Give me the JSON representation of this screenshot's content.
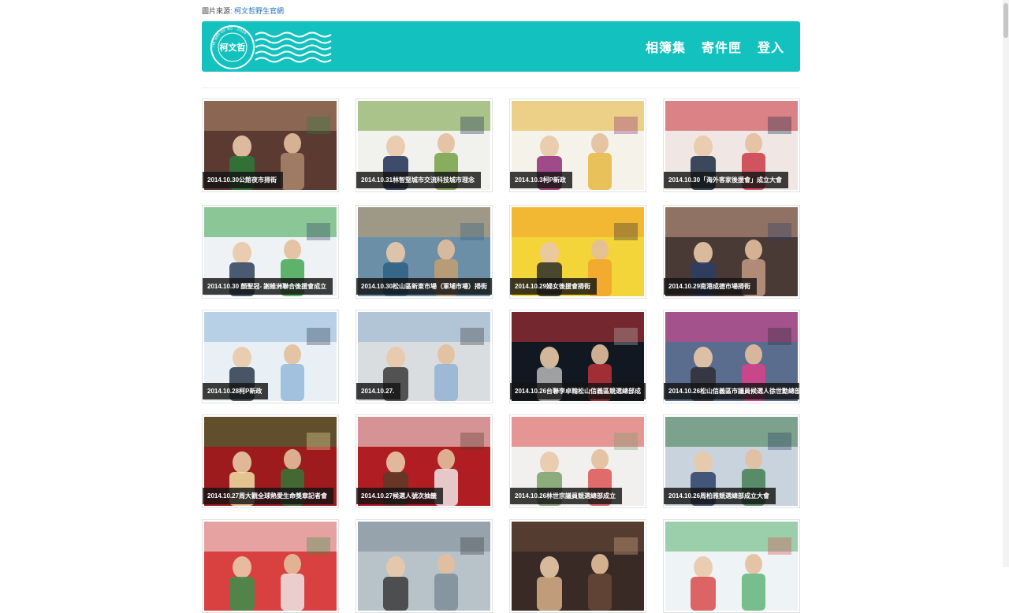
{
  "source": {
    "label": "圖片來源:",
    "link": "柯文哲野生官網"
  },
  "brand": {
    "logo_text": "柯文哲",
    "logo_ring_text": "I'm with Dr. Ko · 2014 ·"
  },
  "nav": [
    {
      "label": "相簿集"
    },
    {
      "label": "寄件匣"
    },
    {
      "label": "登入"
    }
  ],
  "albums": [
    {
      "caption": "2014.10.30公館夜市掃街",
      "scene": "market-night",
      "c1": "#5b3a32",
      "c2": "#b28c6f",
      "c3": "#2d7a3a"
    },
    {
      "caption": "2014.10.31林智堅城市交流科技城市理念",
      "scene": "stage",
      "c1": "#f1f1ee",
      "c2": "#6f9c3a",
      "c3": "#1f2f55"
    },
    {
      "caption": "2014.10.3柯P新政",
      "scene": "press",
      "c1": "#f5f2ea",
      "c2": "#e6b437",
      "c3": "#8f2e7a"
    },
    {
      "caption": "2014.10.30「海外客家後援會」成立大會",
      "scene": "banner",
      "c1": "#f0e6e3",
      "c2": "#c8303b",
      "c3": "#1b2b44"
    },
    {
      "caption": "2014.10.30 顏聖冠- 謝維洲聯合後援會成立",
      "scene": "office",
      "c1": "#eef2f4",
      "c2": "#3aa24a",
      "c3": "#2b3f5a"
    },
    {
      "caption": "2014.10.30松山區新東市場（軍埔市場）掃街",
      "scene": "market",
      "c1": "#6c8fa8",
      "c2": "#c9a06a",
      "c3": "#2e5f86"
    },
    {
      "caption": "2014.10.29婦女後援會掃街",
      "scene": "posters",
      "c1": "#f3d53a",
      "c2": "#f2a02d",
      "c3": "#2d2d2d"
    },
    {
      "caption": "2014.10.29南港成德市場掃街",
      "scene": "crowd",
      "c1": "#4a3a36",
      "c2": "#c9a089",
      "c3": "#2a3e66"
    },
    {
      "caption": "2014.10.28柯P新政",
      "scene": "press-blue",
      "c1": "#e9f0f5",
      "c2": "#8fb7d8",
      "c3": "#2b3a4a"
    },
    {
      "caption": "2014.10.27.",
      "scene": "desk",
      "c1": "#d9dde0",
      "c2": "#8fb0cf",
      "c3": "#3a3a3a"
    },
    {
      "caption": "2014.10.26台聯李卓翰松山信義區競選總部成",
      "scene": "night-car",
      "c1": "#121821",
      "c2": "#c5343a",
      "c3": "#b8b8b8"
    },
    {
      "caption": "2014.10.26松山信義區市議員候選人徐世勳總部",
      "scene": "street-dusk",
      "c1": "#5a6d8e",
      "c2": "#e23d8a",
      "c3": "#2f2f35"
    },
    {
      "caption": "2014.10.27周大觀全球熱愛生命獎章記者會",
      "scene": "red-banner",
      "c1": "#9d1a1d",
      "c2": "#2f7a3a",
      "c3": "#f0e2a5"
    },
    {
      "caption": "2014.10.27候選人號次抽籤",
      "scene": "red-hall",
      "c1": "#b01d22",
      "c2": "#f4f4f4",
      "c3": "#5a3b28"
    },
    {
      "caption": "2014.10.26林世宗議員競選總部成立",
      "scene": "crowd-bright",
      "c1": "#f2f0ee",
      "c2": "#d94a4a",
      "c3": "#7aa06a"
    },
    {
      "caption": "2014.10.26周柏雅競選總部成立大會",
      "scene": "street-crowd",
      "c1": "#c9d3de",
      "c2": "#3c7a4a",
      "c3": "#2b3f66"
    },
    {
      "caption": "",
      "scene": "tent",
      "c1": "#d94040",
      "c2": "#f0f0f0",
      "c3": "#3a8f4a"
    },
    {
      "caption": "",
      "scene": "city",
      "c1": "#b8c2c9",
      "c2": "#7a8a96",
      "c3": "#3a3a3a"
    },
    {
      "caption": "",
      "scene": "dark-stage",
      "c1": "#3a2a26",
      "c2": "#6a4a3a",
      "c3": "#d9b08a"
    },
    {
      "caption": "",
      "scene": "outdoor",
      "c1": "#eef3f5",
      "c2": "#58b070",
      "c3": "#d84a4a"
    }
  ]
}
